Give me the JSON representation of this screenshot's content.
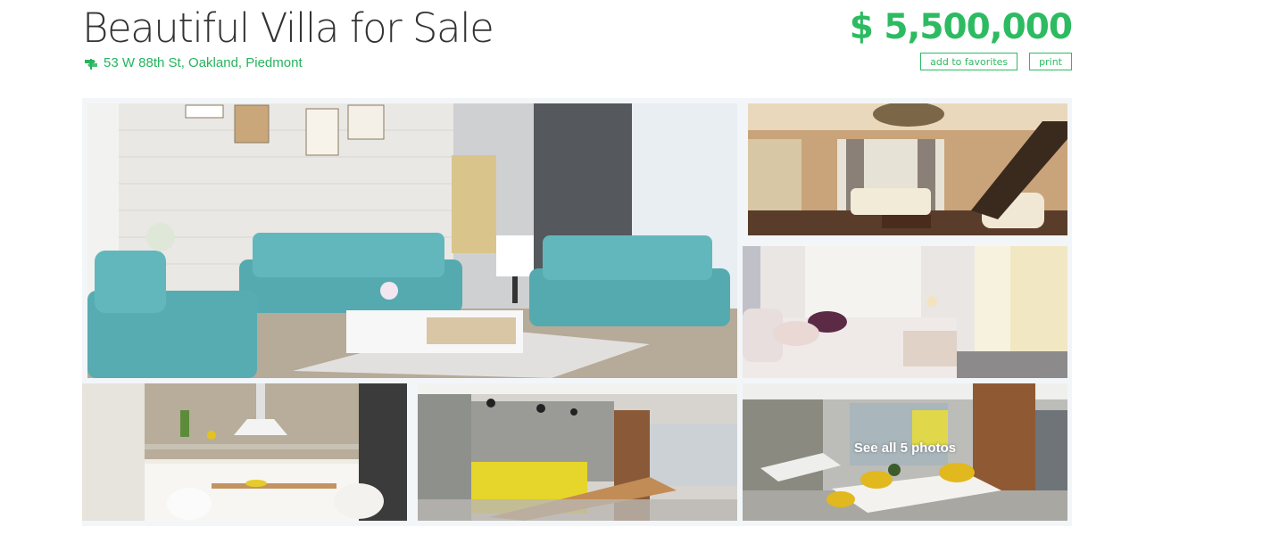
{
  "listing": {
    "title": "Beautiful Villa for Sale",
    "address": "53 W 88th St, Oakland, Piedmont",
    "price": "$ 5,500,000",
    "address_icon": "signpost-icon"
  },
  "actions": {
    "favorites_label": "add to favorites",
    "print_label": "print"
  },
  "gallery": {
    "see_all_label": "See all 5 photos"
  },
  "colors": {
    "accent": "#2dbb62",
    "title": "#333333",
    "gallery_background": "#f3f6f9"
  }
}
